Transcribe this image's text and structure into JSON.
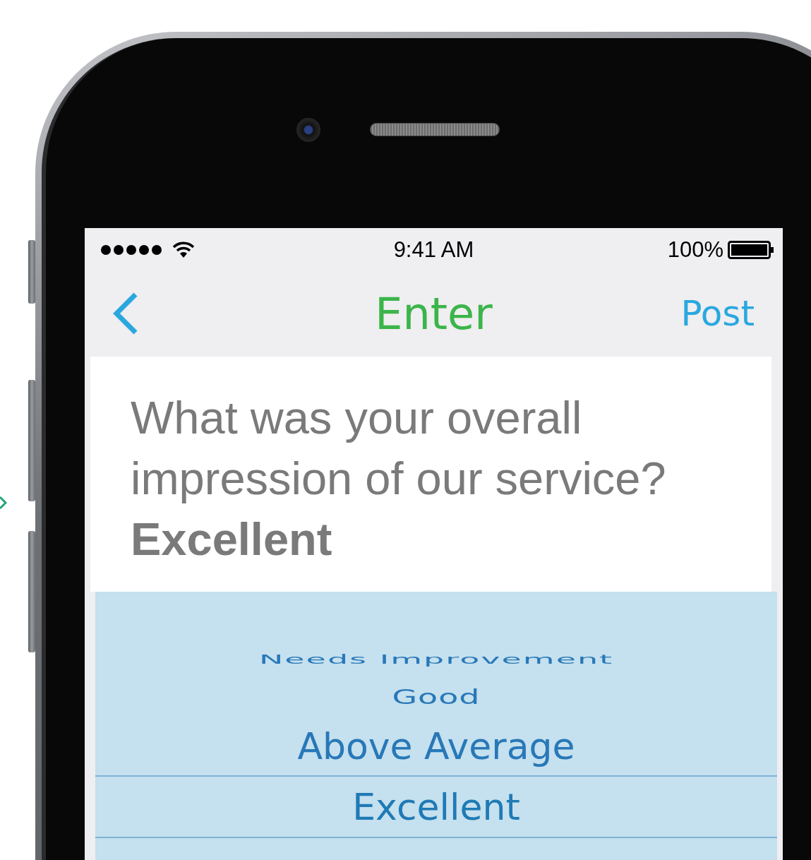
{
  "status_bar": {
    "time": "9:41 AM",
    "battery": "100%"
  },
  "nav_bar": {
    "title": "Enter",
    "action": "Post"
  },
  "question": {
    "text": "What was your overall impression of our service?",
    "answer": "Excellent"
  },
  "picker": {
    "items": [
      {
        "label": "Needs Improvement",
        "selected": false
      },
      {
        "label": "Good",
        "selected": false
      },
      {
        "label": "Above Average",
        "selected": false
      },
      {
        "label": "Excellent",
        "selected": true
      }
    ]
  }
}
